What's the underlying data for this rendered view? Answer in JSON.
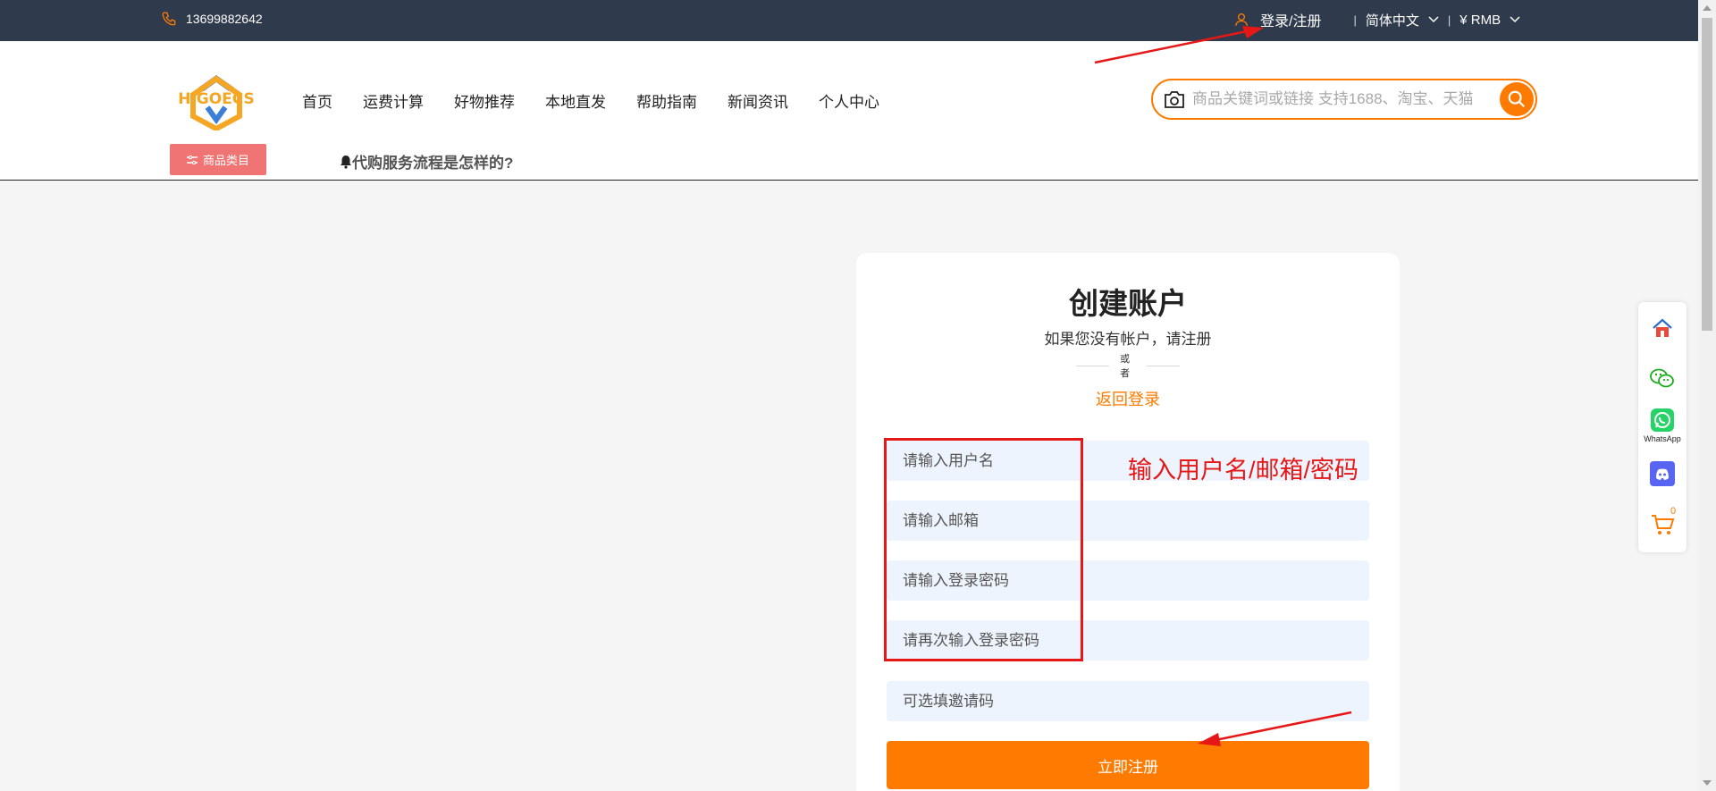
{
  "topbar": {
    "phone": "13699882642",
    "login_label": "登录/注册",
    "language": "简体中文",
    "currency": "¥ RMB",
    "separator": "|"
  },
  "header": {
    "logo_text": "HIGOECS",
    "nav": [
      "首页",
      "运费计算",
      "好物推荐",
      "本地直发",
      "帮助指南",
      "新闻资讯",
      "个人中心"
    ],
    "search_placeholder": "商品关键词或链接 支持1688、淘宝、天猫",
    "category_button": "商品类目",
    "notice": "代购服务流程是怎样的?"
  },
  "register": {
    "title": "创建账户",
    "subtitle": "如果您没有帐户，请注册",
    "or": "或者",
    "back_login": "返回登录",
    "username_placeholder": "请输入用户名",
    "email_placeholder": "请输入邮箱",
    "password_placeholder": "请输入登录密码",
    "confirm_placeholder": "请再次输入登录密码",
    "invite_placeholder": "可选填邀请码",
    "submit": "立即注册"
  },
  "annotation": {
    "label": "输入用户名/邮箱/密码",
    "color": "#e61717"
  },
  "side_toolbar": {
    "items": [
      "home-icon",
      "wechat-icon",
      "whatsapp-icon",
      "discord-icon",
      "cart-icon"
    ],
    "whatsapp_label": "WhatsApp",
    "cart_count": "0"
  },
  "colors": {
    "topbar": "#2f3b4c",
    "accent": "#ff7a00",
    "category_button": "#f07474"
  }
}
